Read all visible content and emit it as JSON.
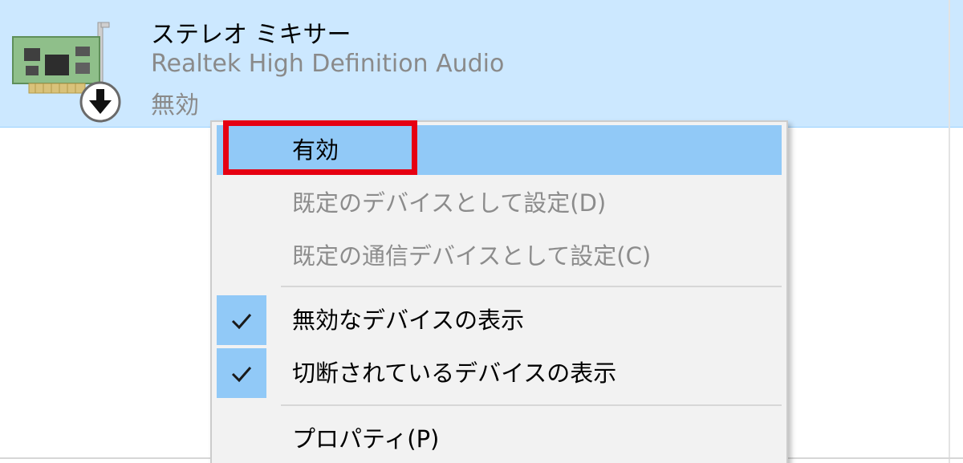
{
  "device": {
    "name": "ステレオ ミキサー",
    "driver": "Realtek High Definition Audio",
    "status": "無効",
    "icon": "sound-card-icon",
    "status_overlay_icon": "disabled-arrow-down-icon"
  },
  "context_menu": {
    "items": [
      {
        "label": "有効",
        "enabled": true,
        "checked": false,
        "highlighted": true
      },
      {
        "label": "既定のデバイスとして設定(D)",
        "enabled": false,
        "checked": false,
        "highlighted": false
      },
      {
        "label": "既定の通信デバイスとして設定(C)",
        "enabled": false,
        "checked": false,
        "highlighted": false
      },
      {
        "label": "無効なデバイスの表示",
        "enabled": true,
        "checked": true,
        "highlighted": false
      },
      {
        "label": "切断されているデバイスの表示",
        "enabled": true,
        "checked": true,
        "highlighted": false
      },
      {
        "label": "プロパティ(P)",
        "enabled": true,
        "checked": false,
        "highlighted": false
      }
    ]
  },
  "colors": {
    "selection_background": "#cce8ff",
    "menu_highlight": "#91c9f7",
    "menu_background": "#f2f2f2",
    "annotation_border": "#e60012",
    "disabled_text": "#8c8c8c"
  }
}
